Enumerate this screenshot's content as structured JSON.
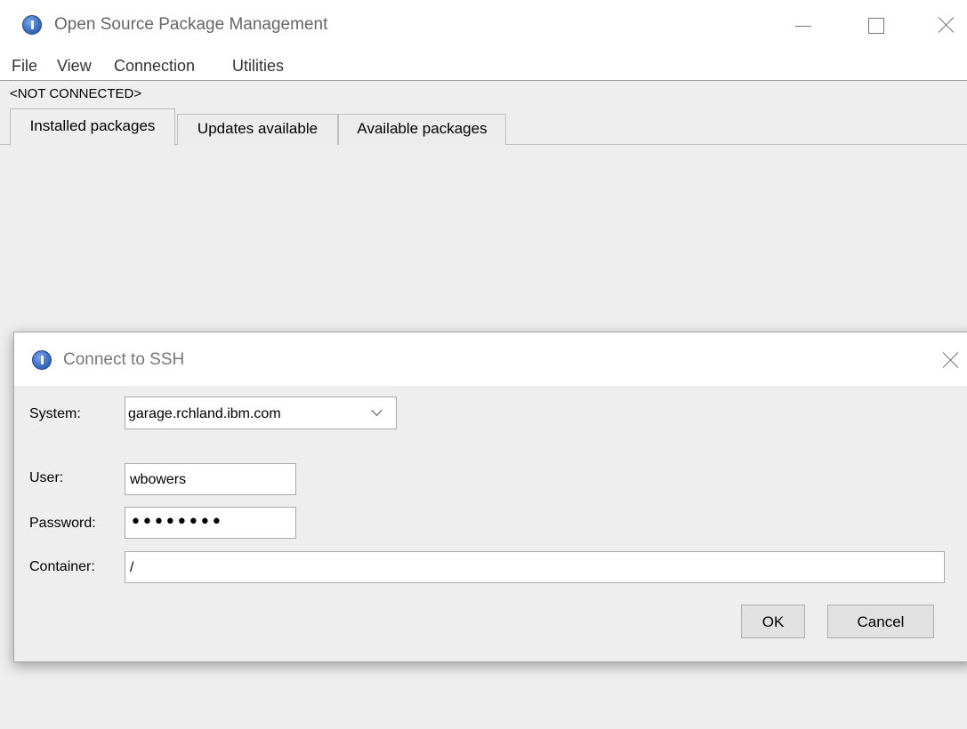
{
  "window": {
    "title": "Open Source Package Management",
    "icon": "java-app-icon"
  },
  "menu": {
    "items": [
      "File",
      "View",
      "Connection",
      "Utilities"
    ]
  },
  "status": "<NOT CONNECTED>",
  "tabs": [
    {
      "label": "Installed packages",
      "active": true
    },
    {
      "label": "Updates available",
      "active": false
    },
    {
      "label": "Available packages",
      "active": false
    }
  ],
  "dialog": {
    "title": "Connect to SSH",
    "system_label": "System:",
    "system_value": "garage.rchland.ibm.com",
    "user_label": "User:",
    "user_value": "wbowers",
    "password_label": "Password:",
    "password_mask": "••••••••",
    "container_label": "Container:",
    "container_value": "/",
    "ok_label": "OK",
    "cancel_label": "Cancel"
  },
  "colors": {
    "background": "#eeeeee",
    "titlebar": "#ffffff",
    "button": "#e1e1e1"
  }
}
